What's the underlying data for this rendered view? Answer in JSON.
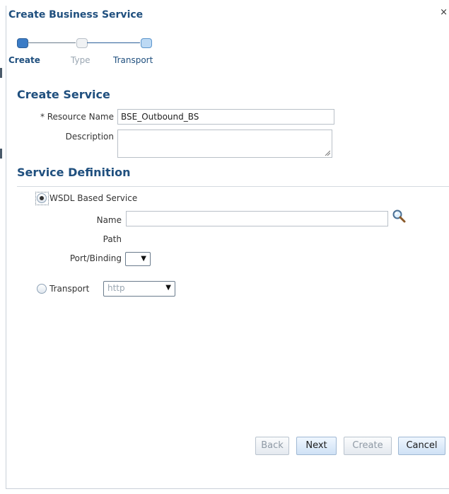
{
  "dialog": {
    "title": "Create Business Service",
    "close_glyph": "×"
  },
  "train": {
    "steps": [
      {
        "label": "Create",
        "state": "active"
      },
      {
        "label": "Type",
        "state": "disabled"
      },
      {
        "label": "Transport",
        "state": "future"
      }
    ]
  },
  "create_service": {
    "heading": "Create Service",
    "resource_name_label": "* Resource Name",
    "resource_name_value": "BSE_Outbound_BS",
    "description_label": "Description",
    "description_value": ""
  },
  "service_definition": {
    "heading": "Service Definition",
    "wsdl_option_label": "WSDL Based Service",
    "wsdl_selected": true,
    "name_label": "Name",
    "name_value": "",
    "path_label": "Path",
    "port_binding_label": "Port/Binding",
    "transport_option_label": "Transport",
    "transport_selected": false,
    "transport_value": "http"
  },
  "buttons": {
    "back": "Back",
    "next": "Next",
    "create": "Create",
    "cancel": "Cancel"
  },
  "icons": {
    "search": "search-icon",
    "close": "close-icon",
    "dropdown": "chevron-down-icon"
  },
  "colors": {
    "heading": "#1f4f7e",
    "accent": "#3b7cc6"
  }
}
